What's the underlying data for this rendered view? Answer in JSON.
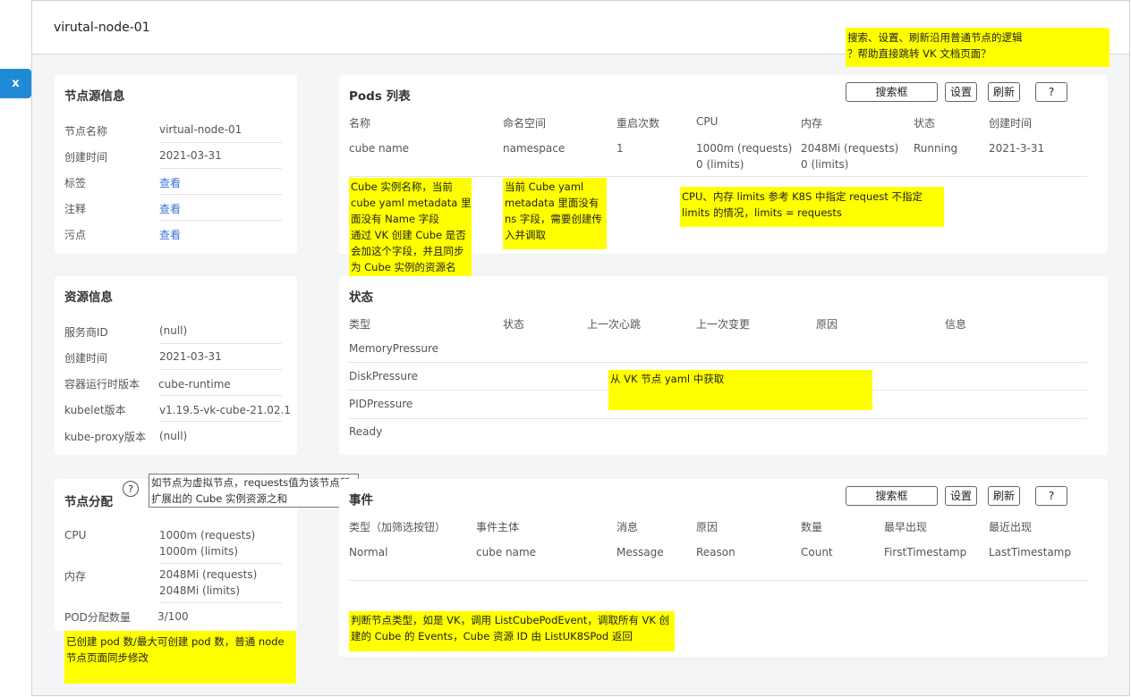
{
  "header": {
    "title": "virutal-node-01"
  },
  "close_label": "x",
  "node_source": {
    "title": "节点源信息",
    "rows": [
      {
        "label": "节点名称",
        "value": "virtual-node-01"
      },
      {
        "label": "创建时间",
        "value": "2021-03-31"
      },
      {
        "label": "标签",
        "value": "查看"
      },
      {
        "label": "注释",
        "value": "查看"
      },
      {
        "label": "污点",
        "value": "查看"
      }
    ]
  },
  "resource_info": {
    "title": "资源信息",
    "rows": [
      {
        "label": "服务商ID",
        "value": "(null)"
      },
      {
        "label": "创建时间",
        "value": "2021-03-31"
      },
      {
        "label": "容器运行时版本",
        "value": "cube-runtime"
      },
      {
        "label": "kubelet版本",
        "value": "v1.19.5-vk-cube-21.02.1"
      },
      {
        "label": "kube-proxy版本",
        "value": "(null)"
      }
    ]
  },
  "node_alloc": {
    "title": "节点分配",
    "help": "?",
    "tooltip": [
      "如节点为虚拟节点，requests值为该节点所",
      "扩展出的 Cube 实例资源之和"
    ],
    "rows": [
      {
        "label": "CPU",
        "value1": "1000m (requests)",
        "value2": "1000m (limits)"
      },
      {
        "label": "内存",
        "value1": "2048Mi (requests)",
        "value2": "2048Mi (limits)"
      },
      {
        "label": "POD分配数量",
        "value1": "3/100",
        "value2": ""
      }
    ],
    "note": [
      "已创建 pod 数/最大可创建 pod 数，普通 node",
      "节点页面同步修改"
    ]
  },
  "top_note": [
    "搜索、设置、刷新沿用普通节点的逻辑",
    "？帮助直接跳转 VK 文档页面？"
  ],
  "pods": {
    "title": "Pods 列表",
    "buttons": {
      "search": "搜索框",
      "settings": "设置",
      "refresh": "刷新",
      "help": "?"
    },
    "headers": [
      "名称",
      "命名空间",
      "重启次数",
      "CPU",
      "内存",
      "状态",
      "创建时间"
    ],
    "row": {
      "name": "cube name",
      "namespace": "namespace",
      "restarts": "1",
      "cpu1": "1000m (requests)",
      "cpu2": "0 (limits)",
      "mem1": "2048Mi (requests)",
      "mem2": "0 (limits)",
      "status": "Running",
      "created": "2021-3-31"
    },
    "note_name": [
      "Cube 实例名称，当前",
      "cube yaml metadata 里",
      "面没有 Name 字段",
      "通过 VK 创建 Cube 是否",
      "会加这个字段，并且同步",
      "为 Cube 实例的资源名"
    ],
    "note_ns": [
      "当前 Cube yaml",
      "metadata 里面没有",
      "ns 字段，需要创建传",
      "入并调取"
    ],
    "note_cpu": [
      "CPU、内存 limits 参考 K8S 中指定 request 不指定",
      "limits 的情况，limits = requests"
    ]
  },
  "conditions": {
    "title": "状态",
    "headers": [
      "类型",
      "状态",
      "上一次心跳",
      "上一次变更",
      "原因",
      "信息"
    ],
    "rows": [
      "MemoryPressure",
      "DiskPressure",
      "PIDPressure",
      "Ready"
    ],
    "note": "从 VK 节点 yaml 中获取"
  },
  "events": {
    "title": "事件",
    "buttons": {
      "search": "搜索框",
      "settings": "设置",
      "refresh": "刷新",
      "help": "?"
    },
    "headers": [
      "类型（加筛选按钮）",
      "事件主体",
      "消息",
      "原因",
      "数量",
      "最早出现",
      "最近出现"
    ],
    "row": [
      "Normal",
      "cube name",
      "Message",
      "Reason",
      "Count",
      "FirstTimestamp",
      "LastTimestamp"
    ],
    "note": [
      "判断节点类型，如是 VK，调用 ListCubePodEvent，调取所有 VK 创",
      "建的 Cube 的 Events，Cube 资源 ID 由 ListUK8SPod 返回"
    ]
  },
  "colors": {
    "note": "#ffff00",
    "accent": "#1f8bd6",
    "link": "#3a76d8"
  }
}
